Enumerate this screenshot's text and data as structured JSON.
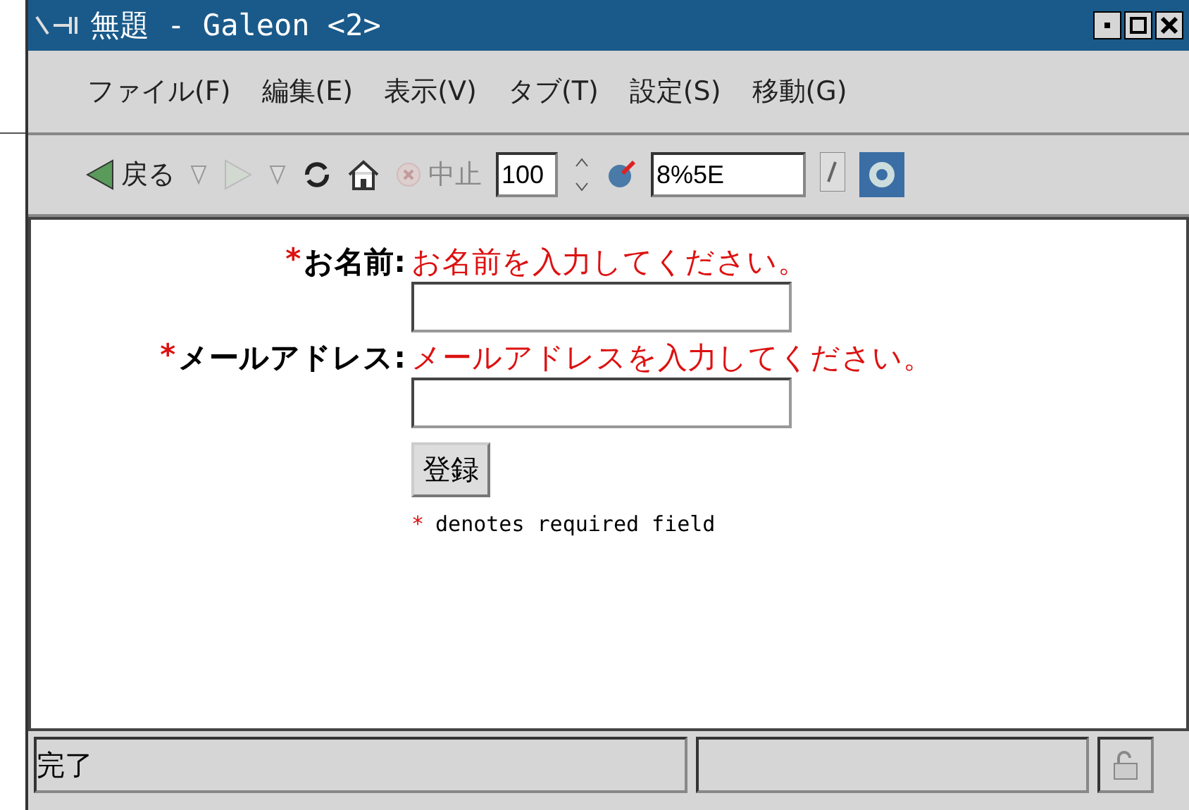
{
  "window": {
    "title": "無題 - Galeon <2>"
  },
  "menu": [
    {
      "label": "ファイル(F)"
    },
    {
      "label": "編集(E)"
    },
    {
      "label": "表示(V)"
    },
    {
      "label": "タブ(T)"
    },
    {
      "label": "設定(S)"
    },
    {
      "label": "移動(G)"
    }
  ],
  "toolbar": [
    {
      "kind": "back",
      "label": "戻る",
      "disabled": false
    },
    {
      "kind": "forward",
      "disabled": true
    },
    {
      "kind": "reload",
      "disabled": false
    },
    {
      "kind": "home",
      "disabled": false
    },
    {
      "kind": "stop",
      "label": "中止",
      "disabled": true
    },
    {
      "kind": "zoom",
      "value": "100"
    },
    {
      "kind": "location",
      "value": "8%5E"
    }
  ],
  "form": {
    "fields": [
      {
        "mark": "*",
        "label": "お名前:",
        "hint": "お名前を入力してください。"
      },
      {
        "mark": "*",
        "label": "メールアドレス:",
        "hint": "メールアドレスを入力してください。"
      }
    ],
    "button": "登録",
    "note_mark": "*",
    "note": "denotes required field"
  },
  "status_bar": {
    "text": "完了"
  }
}
